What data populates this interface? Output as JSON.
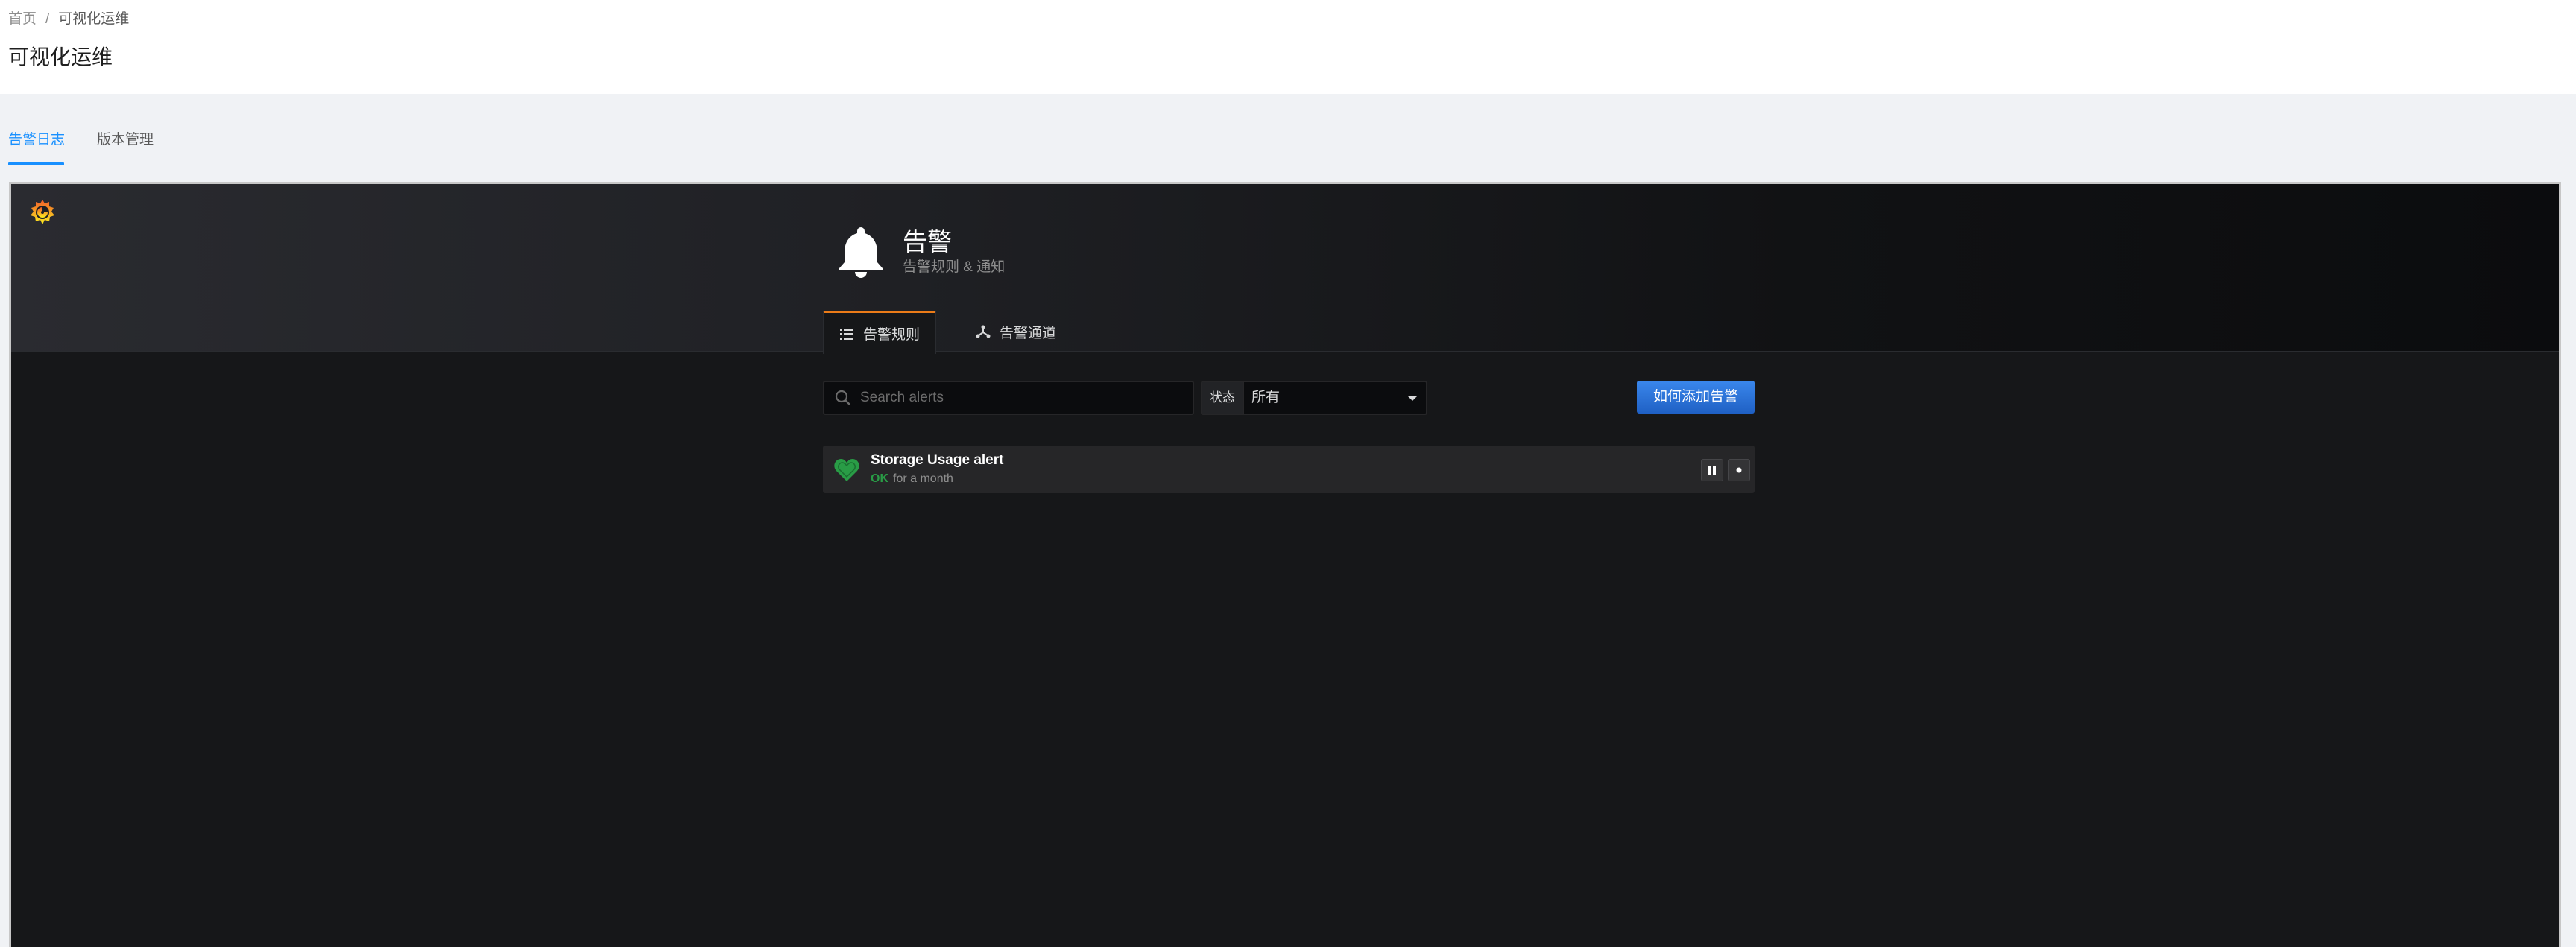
{
  "breadcrumb": {
    "home": "首页",
    "separator": "/",
    "current": "可视化运维"
  },
  "page": {
    "title": "可视化运维"
  },
  "tabs": [
    {
      "label": "告警日志"
    },
    {
      "label": "版本管理"
    }
  ],
  "grafana": {
    "header": {
      "title": "告警",
      "subtitle": "告警规则 & 通知"
    },
    "tabs": [
      {
        "label": "告警规则"
      },
      {
        "label": "告警通道"
      }
    ],
    "search": {
      "placeholder": "Search alerts",
      "value": ""
    },
    "state_filter": {
      "label": "状态",
      "selected": "所有"
    },
    "add_button": "如何添加告警",
    "alerts": [
      {
        "name": "Storage Usage alert",
        "state": "OK",
        "duration": "for a month"
      }
    ]
  },
  "colors": {
    "accent": "#1890ff",
    "grafana_orange": "#eb7b18",
    "ok_green": "#299c46",
    "primary_button": "#1f60c4"
  },
  "icons": [
    "grafana-logo-icon",
    "bell-icon",
    "list-icon",
    "channels-icon",
    "search-icon",
    "heart-icon",
    "pause-icon",
    "edit-icon"
  ]
}
